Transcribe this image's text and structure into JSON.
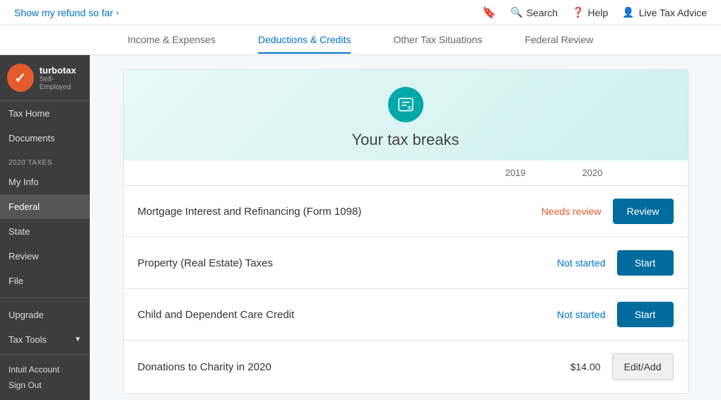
{
  "topBar": {
    "refundLabel": "Show my refund so far",
    "refundChevron": "›",
    "bookmarkTitle": "Bookmark",
    "searchLabel": "Search",
    "helpLabel": "Help",
    "liveAdviceLabel": "Live Tax Advice"
  },
  "tabs": [
    {
      "id": "income",
      "label": "Income & Expenses",
      "active": false
    },
    {
      "id": "deductions",
      "label": "Deductions & Credits",
      "active": true
    },
    {
      "id": "other",
      "label": "Other Tax Situations",
      "active": false
    },
    {
      "id": "federal",
      "label": "Federal Review",
      "active": false
    }
  ],
  "sidebar": {
    "logoText": "turbotax",
    "logoSubtitle": "Self-Employed",
    "checkmark": "✓",
    "sectionLabel": "2020 TAXES",
    "navItems": [
      {
        "id": "tax-home",
        "label": "Tax Home",
        "active": false
      },
      {
        "id": "documents",
        "label": "Documents",
        "active": false
      },
      {
        "id": "my-info",
        "label": "My Info",
        "active": false
      },
      {
        "id": "federal",
        "label": "Federal",
        "active": true
      },
      {
        "id": "state",
        "label": "State",
        "active": false
      },
      {
        "id": "review",
        "label": "Review",
        "active": false
      },
      {
        "id": "file",
        "label": "File",
        "active": false
      }
    ],
    "bottomItems": [
      {
        "id": "upgrade",
        "label": "Upgrade"
      },
      {
        "id": "tax-tools",
        "label": "Tax Tools",
        "hasChevron": true
      }
    ],
    "footerItems": [
      {
        "id": "intuit-account",
        "label": "Intuit Account"
      },
      {
        "id": "sign-out",
        "label": "Sign Out"
      }
    ]
  },
  "main": {
    "taxBreaks": {
      "title": "Your tax breaks",
      "iconTitle": "tax-breaks",
      "yearLabels": [
        "2019",
        "2020"
      ],
      "items": [
        {
          "id": "mortgage-interest",
          "name": "Mortgage Interest and Refinancing (Form 1098)",
          "status": "Needs review",
          "statusType": "needs-review",
          "buttonLabel": "Review",
          "buttonType": "review",
          "amount": null
        },
        {
          "id": "property-taxes",
          "name": "Property (Real Estate) Taxes",
          "status": "Not started",
          "statusType": "not-started",
          "buttonLabel": "Start",
          "buttonType": "start",
          "amount": null
        },
        {
          "id": "child-dependent",
          "name": "Child and Dependent Care Credit",
          "status": "Not started",
          "statusType": "not-started",
          "buttonLabel": "Start",
          "buttonType": "start",
          "amount": null
        },
        {
          "id": "donations-charity",
          "name": "Donations to Charity in 2020",
          "status": null,
          "statusType": "amount",
          "buttonLabel": "Edit/Add",
          "buttonType": "edit-add",
          "amount": "$14.00"
        }
      ]
    }
  }
}
